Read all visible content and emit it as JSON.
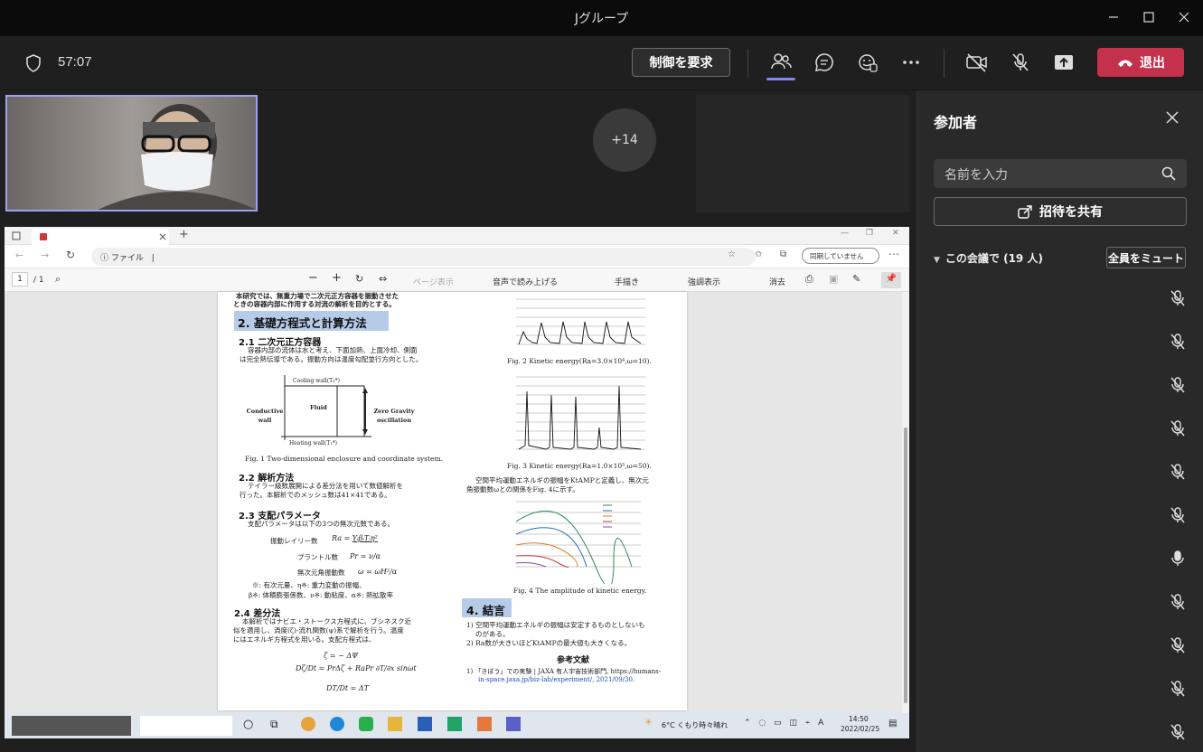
{
  "window": {
    "title": "Jグループ"
  },
  "call": {
    "duration": "57:07",
    "request_control_label": "制御を要求",
    "leave_label": "退出",
    "overflow_count": "+14"
  },
  "panel": {
    "title": "参加者",
    "search_placeholder": "名前を入力",
    "invite_label": "招待を共有",
    "meeting_section": "この会議で (19 人)",
    "mute_all_label": "全員をミュート",
    "participant_mics": [
      "muted",
      "muted",
      "muted",
      "muted",
      "muted",
      "muted",
      "unmuted",
      "muted",
      "muted",
      "muted",
      "muted"
    ]
  },
  "browser": {
    "url_prefix": "ファイル",
    "url": "|",
    "sync_status": "同期していません",
    "pdf_page": "1",
    "pdf_total": "/ 1",
    "pdf_tools": {
      "page_view": "ページ表示",
      "read_aloud": "音声で読み上げる",
      "draw": "手描き",
      "highlight": "強調表示",
      "erase": "消去"
    }
  },
  "paper": {
    "intro_line1": "本研究では、無重力場で二次元正方容器を振動させた",
    "intro_line2": "ときの容器内部に作用する対流の解析を目的とする。",
    "h2_basic": "2. 基礎方程式と計算方法",
    "h3_21": "2.1 二次元正方容器",
    "p_21a": "容器内部の流体は水と考え、下面加熱、上面冷却、側面",
    "p_21b": "は完全熱伝導である。振動方向は温度勾配並行方向とした。",
    "fig1_cooling": "Cooling wall(T₀*)",
    "fig1_heating": "Heating wall(T₁*)",
    "fig1_conductive": "Conductive wall",
    "fig1_fluid": "Fluid",
    "fig1_zero": "Zero Gravity oscillation",
    "fig1_caption": "Fig. 1 Two-dimensional enclosure and coordinate system.",
    "h3_22": "2.2 解析方法",
    "p_22a": "テイラー級数展開による差分法を用いて数値解析を",
    "p_22b": "行った。本解析でのメッシュ数は41×41である。",
    "h3_23": "2.3 支配パラメータ",
    "p_23a": "支配パラメータは以下の3つの無次元数である。",
    "param_ra": "振動レイリー数",
    "param_pr": "プラントル数",
    "param_omega": "無次元角振動数",
    "note_a": "※: 有次元量、η※: 重力変動の振幅、",
    "note_b": "β※: 体積膨張係数、ν※: 動粘度、α※: 熱拡散率",
    "h3_24": "2.4 差分法",
    "p_24a": "本解析ではナビエ・ストークス方程式に、ブシネスク近",
    "p_24b": "似を適用し、渦度(ζ)-流れ関数(ψ)系で解析を行う。温度",
    "p_24c": "にはエネルギ方程式を用いる。支配方程式は、",
    "fig2_caption": "Fig. 2 Kinetic energy(Ra=3.0×10⁴,ω=10).",
    "fig3_caption": "Fig. 3 Kinetic energy(Ra=1.0×10⁵,ω=50).",
    "p_ke_a": "空間平均運動エネルギの振幅をKtAMPと定義し、無次元",
    "p_ke_b": "角振動数ωとの関係をFig. 4に示す。",
    "fig4_caption": "Fig. 4 The amplitude of kinetic energy.",
    "h2_conclusion": "4. 結言",
    "concl_1a": "1) 空間平均運動エネルギの振幅は安定するものとしないも",
    "concl_1b": "のがある。",
    "concl_2": "2) Ra数が大きいほどKtAMPの最大値も大きくなる。",
    "ref_title": "参考文献",
    "ref_1a": "1) 「きぼう」での実験 | JAXA 有人宇宙技術部門, https://humans-",
    "ref_1b": "in-space.jaxa.jp/biz-lab/experiment/, 2021/09/30."
  },
  "taskbar": {
    "weather": "6°C くもり時々晴れ",
    "time": "14:50",
    "date": "2022/02/25"
  }
}
